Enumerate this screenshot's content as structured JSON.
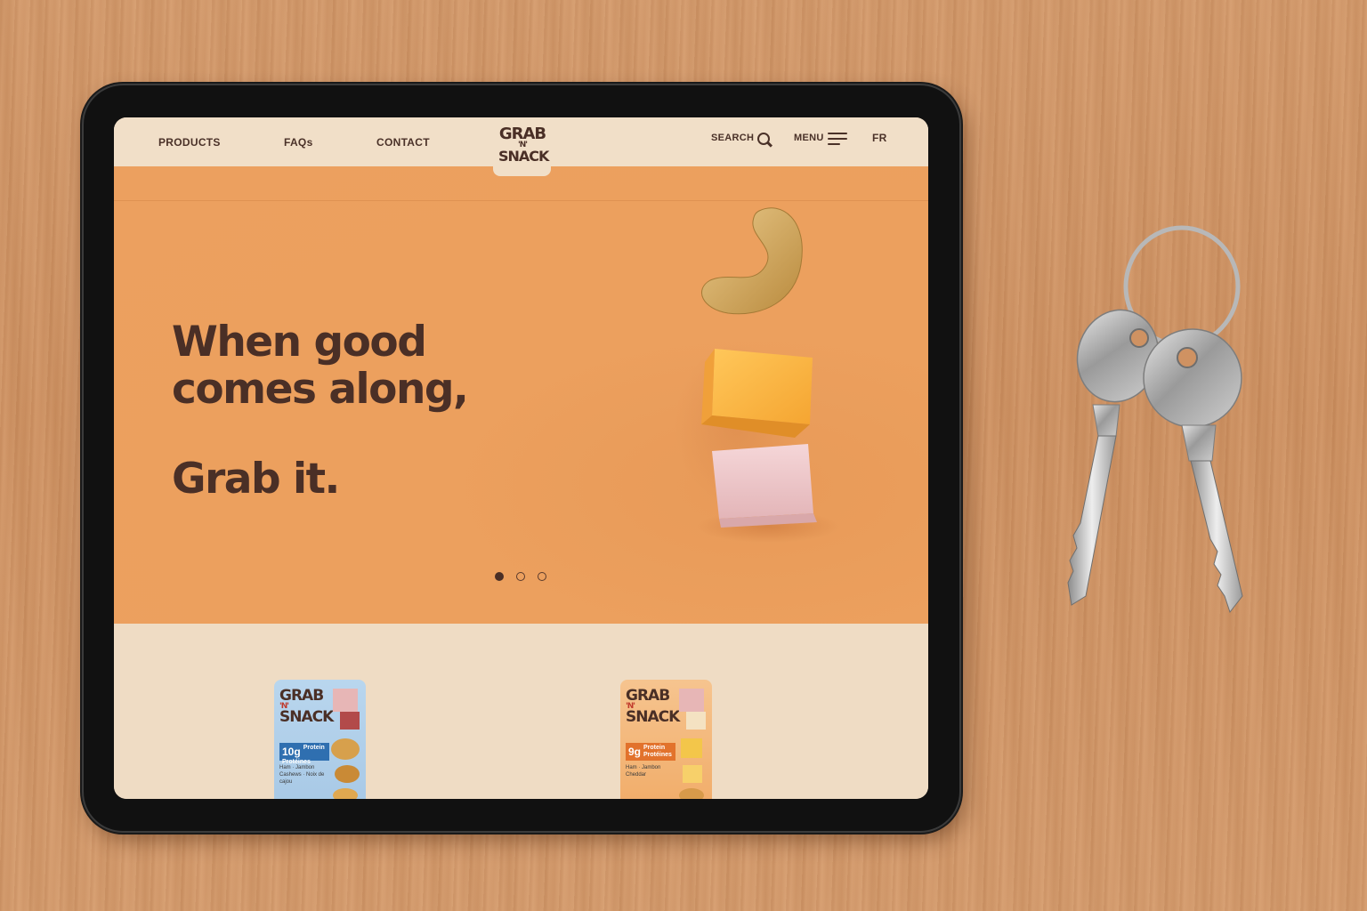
{
  "nav": {
    "products": "PRODUCTS",
    "faqs": "FAQs",
    "contact": "CONTACT",
    "search": "SEARCH",
    "menu": "MENU",
    "lang": "FR"
  },
  "logo": {
    "line1": "GRAB",
    "line2": "'N'",
    "line3": "SNACK"
  },
  "hero": {
    "headline_line1": "When good",
    "headline_line2": "comes along,",
    "tagline": "Grab it.",
    "carousel": {
      "slides": 3,
      "active": 1
    }
  },
  "products": [
    {
      "brand_line1": "GRAB",
      "brand_line2": "'N'",
      "brand_line3": "SNACK",
      "protein_value": "10g",
      "protein_label": "Protein Protéines",
      "flavor": "Ham · Jambon  Cashews · Noix de cajou",
      "color": "#a8c9e6"
    },
    {
      "brand_line1": "GRAB",
      "brand_line2": "'N'",
      "brand_line3": "SNACK",
      "protein_value": "9g",
      "protein_label": "Protein Protéines",
      "flavor": "Ham · Jambon  Cheddar",
      "color": "#f1ad6a"
    }
  ],
  "colors": {
    "brand_brown": "#4a2f26",
    "hero_orange": "#eca05f",
    "cream": "#f1dfc8"
  }
}
